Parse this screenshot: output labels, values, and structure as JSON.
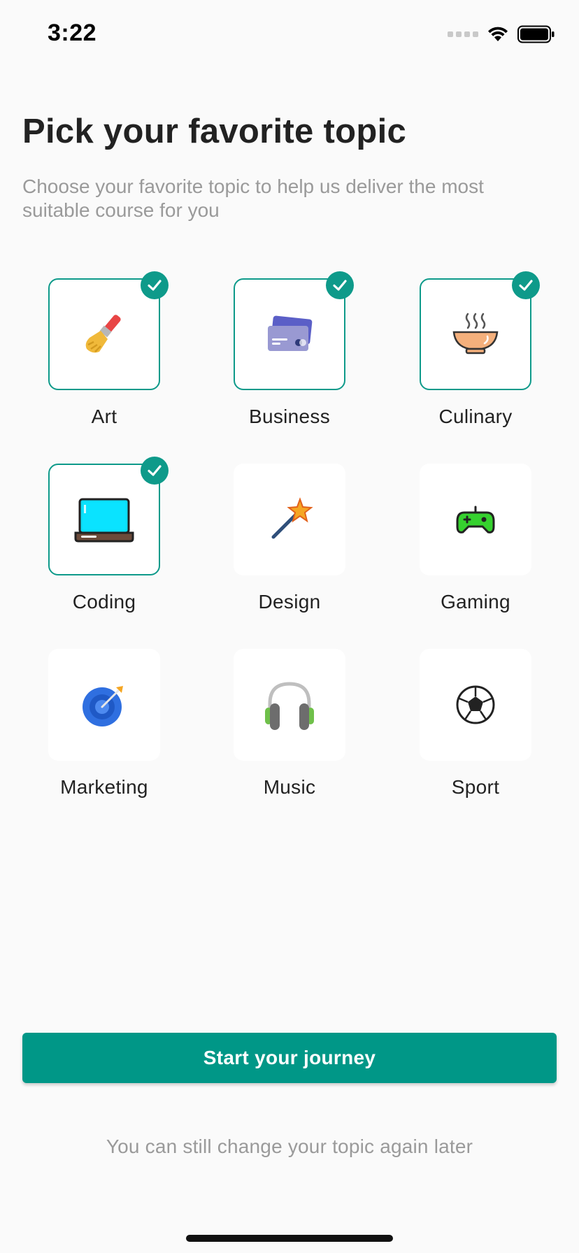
{
  "status_bar": {
    "time": "3:22",
    "icons": [
      "signal-icon",
      "wifi-icon",
      "battery-icon"
    ]
  },
  "header": {
    "title": "Pick your favorite topic",
    "subtitle": "Choose your favorite topic to help us deliver the most suitable course for you"
  },
  "topics": [
    {
      "label": "Art",
      "icon": "paint-brush-icon",
      "selected": true
    },
    {
      "label": "Business",
      "icon": "credit-cards-icon",
      "selected": true
    },
    {
      "label": "Culinary",
      "icon": "hot-bowl-icon",
      "selected": true
    },
    {
      "label": "Coding",
      "icon": "laptop-icon",
      "selected": true
    },
    {
      "label": "Design",
      "icon": "magic-wand-icon",
      "selected": false
    },
    {
      "label": "Gaming",
      "icon": "gamepad-icon",
      "selected": false
    },
    {
      "label": "Marketing",
      "icon": "target-icon",
      "selected": false
    },
    {
      "label": "Music",
      "icon": "headphones-icon",
      "selected": false
    },
    {
      "label": "Sport",
      "icon": "soccer-ball-icon",
      "selected": false
    }
  ],
  "cta": {
    "label": "Start your journey"
  },
  "footnote": "You can still change your topic again later",
  "colors": {
    "accent": "#009787",
    "selected_border": "#0e9a8a",
    "background": "#fafafa",
    "muted_text": "#9a9a9a"
  }
}
